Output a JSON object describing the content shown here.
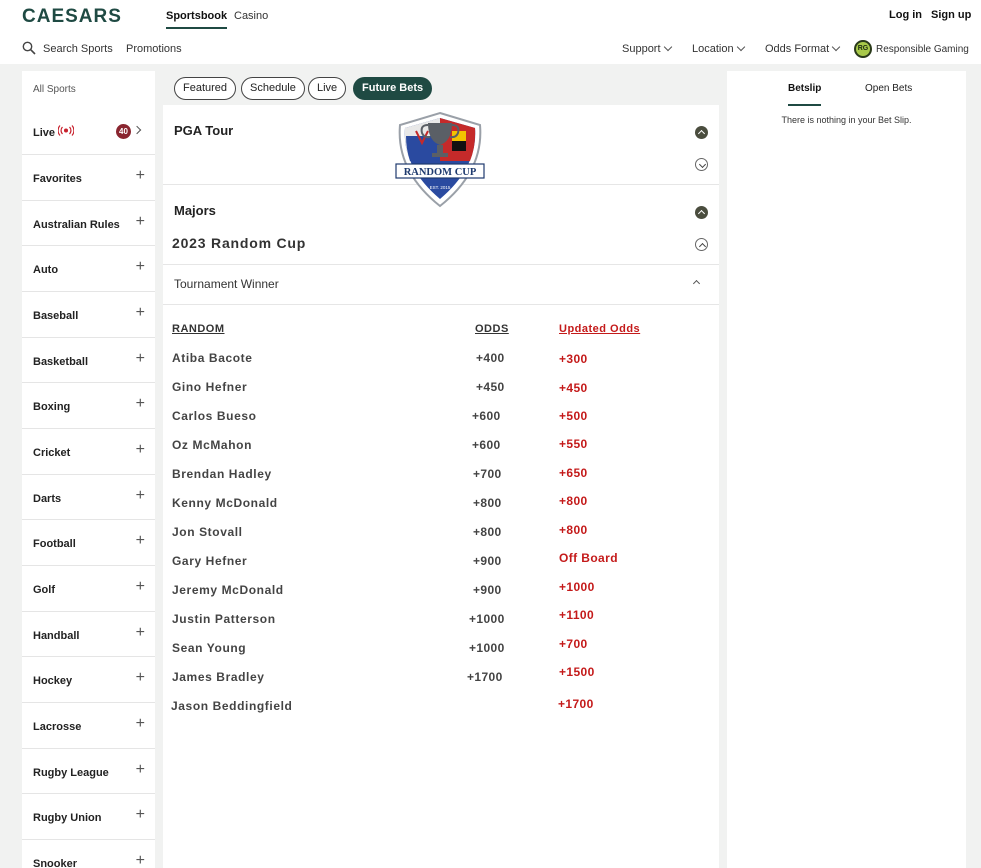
{
  "header": {
    "brand": "CAESARS",
    "tabs": [
      "Sportsbook",
      "Casino"
    ],
    "login": "Log in",
    "signup": "Sign up",
    "search": "Search Sports",
    "promotions": "Promotions",
    "support": "Support",
    "location": "Location",
    "odds_format": "Odds Format",
    "rg_badge": "RG",
    "responsible_gaming": "Responsible Gaming"
  },
  "sidebar": {
    "all_sports": "All Sports",
    "live_label": "Live",
    "live_count": "40",
    "items": [
      "Favorites",
      "Australian Rules",
      "Auto",
      "Baseball",
      "Basketball",
      "Boxing",
      "Cricket",
      "Darts",
      "Football",
      "Golf",
      "Handball",
      "Hockey",
      "Lacrosse",
      "Rugby League",
      "Rugby Union",
      "Snooker"
    ]
  },
  "filters": [
    "Featured",
    "Schedule",
    "Live",
    "Future Bets"
  ],
  "main": {
    "section1": "PGA Tour",
    "section2": "Majors",
    "event_title": "2023 Random Cup",
    "market": "Tournament Winner",
    "logo_text": "RANDOM CUP",
    "logo_est": "EST. 2015",
    "col_player": "RANDOM",
    "col_odds": "ODDS",
    "col_updated": "Updated Odds",
    "rows": [
      {
        "name": "Atiba Bacote",
        "odds": "+400",
        "updated": "+300"
      },
      {
        "name": "Gino Hefner",
        "odds": "+450",
        "updated": "+450"
      },
      {
        "name": "Carlos Bueso",
        "odds": "+600",
        "updated": "+500"
      },
      {
        "name": "Oz McMahon",
        "odds": "+600",
        "updated": "+550"
      },
      {
        "name": "Brendan Hadley",
        "odds": "+700",
        "updated": "+650"
      },
      {
        "name": "Kenny McDonald",
        "odds": "+800",
        "updated": "+800"
      },
      {
        "name": "Jon Stovall",
        "odds": "+800",
        "updated": "+800"
      },
      {
        "name": "Gary Hefner",
        "odds": "+900",
        "updated": "Off Board"
      },
      {
        "name": "Jeremy McDonald",
        "odds": "+900",
        "updated": "+1000"
      },
      {
        "name": "Justin Patterson",
        "odds": "+1000",
        "updated": "+1100"
      },
      {
        "name": "Sean Young",
        "odds": "+1000",
        "updated": "+700"
      },
      {
        "name": "James Bradley",
        "odds": "+1700",
        "updated": "+1500"
      },
      {
        "name": "Jason Beddingfield",
        "odds": "",
        "updated": "+1700"
      }
    ]
  },
  "betslip": {
    "tab_betslip": "Betslip",
    "tab_open": "Open Bets",
    "empty": "There is nothing in your Bet Slip."
  },
  "colors": {
    "brand": "#1f4a43",
    "odds_red": "#c41a1a",
    "live_badge": "#8a2630"
  }
}
